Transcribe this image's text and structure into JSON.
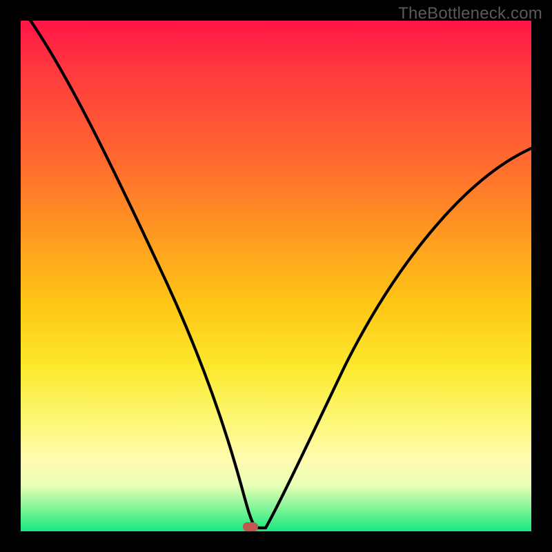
{
  "watermark": "TheBottleneck.com",
  "colors": {
    "frame_bg": "#000000",
    "curve_stroke": "#000000",
    "marker_fill": "#c0584e",
    "gradient_stops": [
      "#ff1546",
      "#ff3a3e",
      "#ff6b2e",
      "#ff9a20",
      "#ffc816",
      "#fce92e",
      "#fdf773",
      "#fffcb0",
      "#e8ffb5",
      "#8cf59a",
      "#17e87e"
    ]
  },
  "chart_data": {
    "type": "line",
    "title": "",
    "xlabel": "",
    "ylabel": "",
    "xlim": [
      0,
      100
    ],
    "ylim": [
      0,
      100
    ],
    "grid": false,
    "legend": null,
    "series": [
      {
        "name": "v-curve",
        "x": [
          0,
          2,
          5,
          8,
          12,
          16,
          20,
          24,
          28,
          32,
          35,
          38,
          40,
          42,
          44,
          46,
          48,
          50,
          54,
          58,
          62,
          66,
          70,
          75,
          80,
          85,
          90,
          95,
          100
        ],
        "y": [
          103,
          98,
          92,
          85,
          77,
          68,
          60,
          51,
          42,
          32,
          25,
          17,
          11,
          6,
          2,
          0,
          0,
          2,
          7,
          14,
          21,
          29,
          37,
          46,
          53,
          60,
          66,
          71,
          75
        ]
      }
    ],
    "marker": {
      "x": 45,
      "y": 0,
      "shape": "rounded-rect",
      "color": "#c0584e"
    },
    "note": "x/y are fractions (0-100) of the colored plot area; y=0 at bottom, y=100 at top. Curve descends steeply from top-left, flattens near x≈44-47 at y≈0, then rises toward the right ending near y≈75."
  }
}
